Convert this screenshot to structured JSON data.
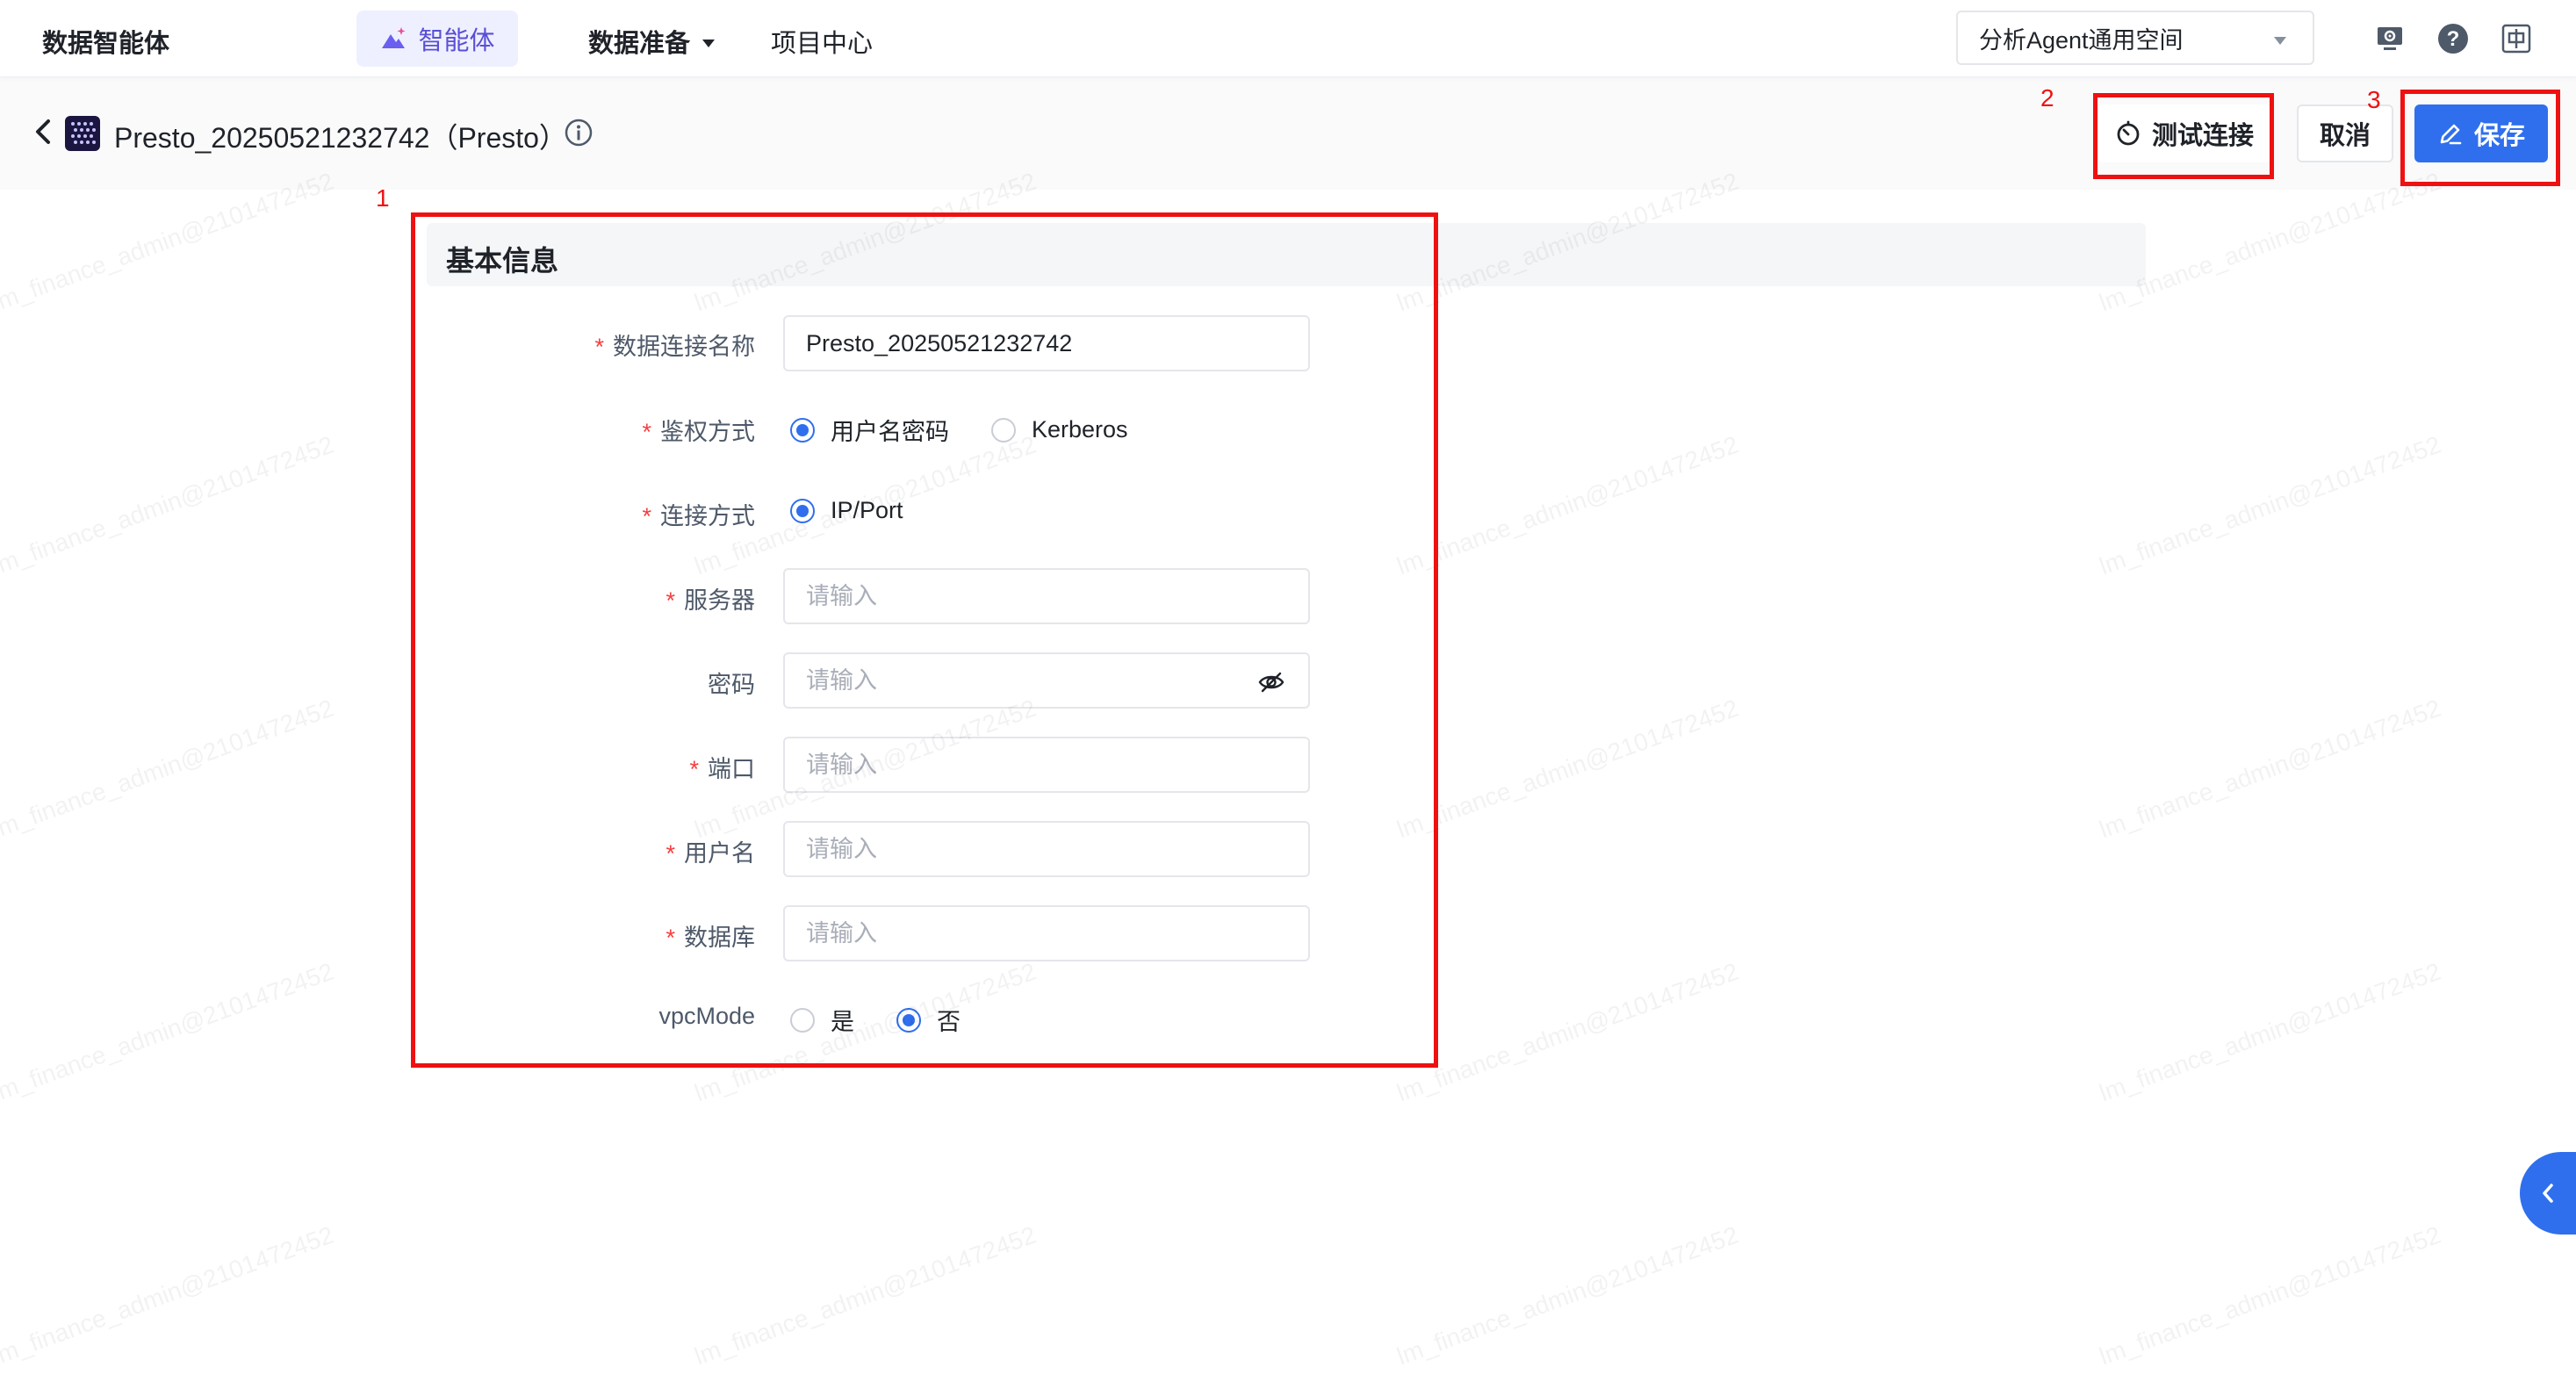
{
  "topbar": {
    "brand": "数据智能体",
    "nav_active": "智能体",
    "nav_data_prep": "数据准备",
    "nav_projects": "项目中心",
    "workspace": "分析Agent通用空间",
    "icons": [
      "monitor-gear-icon",
      "help-icon",
      "language-icon"
    ]
  },
  "header": {
    "title": "Presto_20250521232742（Presto）",
    "test_label": "测试连接",
    "cancel_label": "取消",
    "save_label": "保存"
  },
  "annotations": [
    "1",
    "2",
    "3"
  ],
  "form": {
    "section_title": "基本信息",
    "required_mark": "*",
    "fields": {
      "name": {
        "label": "数据连接名称",
        "value": "Presto_20250521232742",
        "required": true
      },
      "auth": {
        "label": "鉴权方式",
        "required": true,
        "options": [
          "用户名密码",
          "Kerberos"
        ],
        "selected": "用户名密码"
      },
      "conn": {
        "label": "连接方式",
        "required": true,
        "options": [
          "IP/Port"
        ],
        "selected": "IP/Port"
      },
      "server": {
        "label": "服务器",
        "placeholder": "请输入",
        "required": true
      },
      "password": {
        "label": "密码",
        "placeholder": "请输入",
        "required": false
      },
      "port": {
        "label": "端口",
        "placeholder": "请输入",
        "required": true
      },
      "username": {
        "label": "用户名",
        "placeholder": "请输入",
        "required": true
      },
      "database": {
        "label": "数据库",
        "placeholder": "请输入",
        "required": true
      },
      "vpc": {
        "label": "vpcMode",
        "required": false,
        "options": [
          "是",
          "否"
        ],
        "selected": "否"
      }
    }
  },
  "watermark": "lm_finance_admin@2101472452",
  "colors": {
    "primary": "#2f6fed",
    "annotation": "#ee1111",
    "required": "#f53f3f",
    "nav_active": "#5a4fd6"
  }
}
